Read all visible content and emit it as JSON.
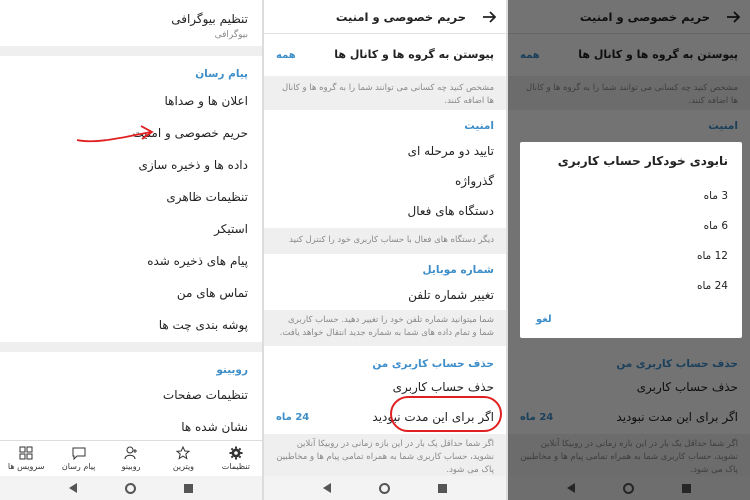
{
  "panel1": {
    "bio_title": "تنظیم بیوگرافی",
    "bio_sub": "بیوگرافی",
    "messenger_header": "پیام رسان",
    "items": [
      "اعلان ها و صداها",
      "حریم خصوصی و امنیت",
      "داده ها و ذخیره سازی",
      "تنظیمات ظاهری",
      "استیکر",
      "پیام های ذخیره شده",
      "تماس های من",
      "پوشه بندی چت ها"
    ],
    "rubino_header": "روبینو",
    "rubino_items": [
      "تنظیمات صفحات",
      "نشان شده ها"
    ],
    "tabs": [
      "سرویس ها",
      "پیام رسان",
      "روبینو",
      "ویترین",
      "تنظیمات"
    ]
  },
  "panel2": {
    "title": "حریم خصوصی و امنیت",
    "join_groups": "پیوستن به گروه ها و کانال ها",
    "join_value": "همه",
    "join_hint": "مشخص کنید چه کسانی می توانند شما را به گروه ها و کانال ها اضافه کنند.",
    "security_header": "امنیت",
    "security_items": [
      "تایید دو مرحله ای",
      "گذرواژه",
      "دستگاه های فعال"
    ],
    "devices_hint": "دیگر دستگاه های فعال با حساب کاربری خود را کنترل کنید",
    "mobile_header": "شماره موبایل",
    "change_number": "تغییر شماره تلفن",
    "mobile_hint": "شما میتوانید شماره تلفن خود را تغییر دهید. حساب کاربری شما و تمام داده های شما به شماره جدید انتقال خواهد یافت.",
    "delete_header": "حذف حساب کاربری من",
    "delete_account": "حذف حساب کاربری",
    "inactive_label": "اگر برای این مدت نبودید",
    "inactive_value": "24 ماه",
    "inactive_hint": "اگر شما حداقل یک بار در این بازه زمانی در روبیکا آنلاین نشوید، حساب کاربری شما به همراه تمامی پیام ها و مخاطبین پاک می شود."
  },
  "panel3": {
    "dialog_title": "نابودی خودکار حساب کاربری",
    "options": [
      "3 ماه",
      "6 ماه",
      "12 ماه",
      "24 ماه"
    ],
    "cancel": "لغو"
  }
}
